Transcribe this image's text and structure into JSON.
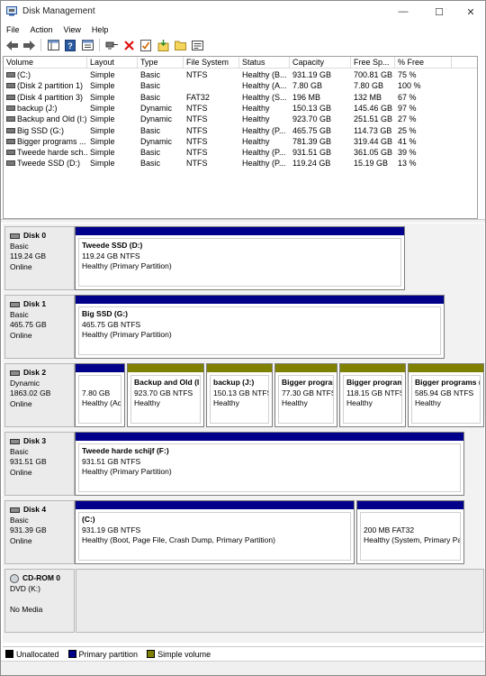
{
  "window": {
    "title": "Disk Management",
    "minimize_glyph": "—",
    "maximize_glyph": "☐",
    "close_glyph": "✕"
  },
  "menu": [
    "File",
    "Action",
    "View",
    "Help"
  ],
  "toolbar": {
    "icons": [
      "back-arrow-icon",
      "forward-arrow-icon",
      "console-tree-icon",
      "help-icon",
      "properties-icon",
      "connect-icon",
      "delete-icon",
      "check-icon",
      "import-icon",
      "folder-icon",
      "view-icon"
    ]
  },
  "volume_list": {
    "columns": [
      "Volume",
      "Layout",
      "Type",
      "File System",
      "Status",
      "Capacity",
      "Free Sp...",
      "% Free"
    ],
    "rows": [
      [
        "(C:)",
        "Simple",
        "Basic",
        "NTFS",
        "Healthy (B...",
        "931.19 GB",
        "700.81 GB",
        "75 %"
      ],
      [
        "(Disk 2 partition 1)",
        "Simple",
        "Basic",
        "",
        "Healthy (A...",
        "7.80 GB",
        "7.80 GB",
        "100 %"
      ],
      [
        "(Disk 4 partition 3)",
        "Simple",
        "Basic",
        "FAT32",
        "Healthy (S...",
        "196 MB",
        "132 MB",
        "67 %"
      ],
      [
        "backup (J:)",
        "Simple",
        "Dynamic",
        "NTFS",
        "Healthy",
        "150.13 GB",
        "145.46 GB",
        "97 %"
      ],
      [
        "Backup and Old (I:)",
        "Simple",
        "Dynamic",
        "NTFS",
        "Healthy",
        "923.70 GB",
        "251.51 GB",
        "27 %"
      ],
      [
        "Big SSD (G:)",
        "Simple",
        "Basic",
        "NTFS",
        "Healthy (P...",
        "465.75 GB",
        "114.73 GB",
        "25 %"
      ],
      [
        "Bigger programs ...",
        "Simple",
        "Dynamic",
        "NTFS",
        "Healthy",
        "781.39 GB",
        "319.44 GB",
        "41 %"
      ],
      [
        "Tweede harde sch...",
        "Simple",
        "Basic",
        "NTFS",
        "Healthy (P...",
        "931.51 GB",
        "361.05 GB",
        "39 %"
      ],
      [
        "Tweede SSD (D:)",
        "Simple",
        "Basic",
        "NTFS",
        "Healthy (P...",
        "119.24 GB",
        "15.19 GB",
        "13 %"
      ]
    ]
  },
  "colors": {
    "primary": "#00008b",
    "simple": "#808000",
    "unallocated": "#000000"
  },
  "disks": [
    {
      "name": "Disk 0",
      "type": "Basic",
      "size": "119.24 GB",
      "state": "Online",
      "partitions": [
        {
          "kind": "primary",
          "name": "Tweede SSD  (D:)",
          "size": "119.24 GB NTFS",
          "status": "Healthy (Primary Partition)"
        }
      ]
    },
    {
      "name": "Disk 1",
      "type": "Basic",
      "size": "465.75 GB",
      "state": "Online",
      "partitions": [
        {
          "kind": "primary",
          "name": "Big SSD  (G:)",
          "size": "465.75 GB NTFS",
          "status": "Healthy (Primary Partition)"
        }
      ]
    },
    {
      "name": "Disk 2",
      "type": "Dynamic",
      "size": "1863.02 GB",
      "state": "Online",
      "partitions": [
        {
          "kind": "primary",
          "name": "",
          "size": "7.80 GB",
          "status": "Healthy (Act"
        },
        {
          "kind": "simple",
          "name": "Backup and Old  (I",
          "size": "923.70 GB NTFS",
          "status": "Healthy"
        },
        {
          "kind": "simple",
          "name": "backup  (J:)",
          "size": "150.13 GB NTFS",
          "status": "Healthy"
        },
        {
          "kind": "simple",
          "name": "Bigger program",
          "size": "77.30 GB NTFS",
          "status": "Healthy"
        },
        {
          "kind": "simple",
          "name": "Bigger program",
          "size": "118.15 GB NTFS",
          "status": "Healthy"
        },
        {
          "kind": "simple",
          "name": "Bigger programs  (",
          "size": "585.94 GB NTFS",
          "status": "Healthy"
        }
      ]
    },
    {
      "name": "Disk 3",
      "type": "Basic",
      "size": "931.51 GB",
      "state": "Online",
      "partitions": [
        {
          "kind": "primary",
          "name": "Tweede harde schijf  (F:)",
          "size": "931.51 GB NTFS",
          "status": "Healthy (Primary Partition)"
        }
      ]
    },
    {
      "name": "Disk 4",
      "type": "Basic",
      "size": "931.39 GB",
      "state": "Online",
      "partitions": [
        {
          "kind": "primary",
          "name": "(C:)",
          "size": "931.19 GB NTFS",
          "status": "Healthy (Boot, Page File, Crash Dump, Primary Partition)"
        },
        {
          "kind": "primary",
          "name": "",
          "size": "200 MB FAT32",
          "status": "Healthy (System, Primary Par"
        }
      ]
    },
    {
      "name": "CD-ROM 0",
      "type": "DVD (K:)",
      "size": "",
      "state": "No Media",
      "cdrom": true,
      "partitions": []
    }
  ],
  "legend": [
    {
      "label": "Unallocated",
      "color": "#000000"
    },
    {
      "label": "Primary partition",
      "color": "#00008b"
    },
    {
      "label": "Simple volume",
      "color": "#808000"
    }
  ]
}
